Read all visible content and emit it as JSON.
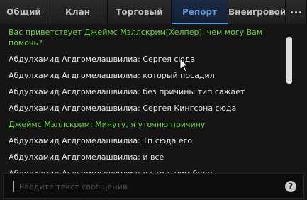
{
  "tabs": [
    {
      "label": "Общий",
      "active": false
    },
    {
      "label": "Клан",
      "active": false
    },
    {
      "label": "Торговый",
      "active": false
    },
    {
      "label": "Репорт",
      "active": true
    },
    {
      "label": "Внеигровой",
      "active": false
    }
  ],
  "messages": [
    {
      "text": "Вас приветствует Джеймс Мэллскрим[Хелпер], чем могу Вам помочь?",
      "kind": "helper"
    },
    {
      "text": "Абдулхамид Агдгомелашвилиа: Сергея сюда",
      "kind": "player"
    },
    {
      "text": "Абдулхамид Агдгомелашвилиа: который посадил",
      "kind": "player"
    },
    {
      "text": "Абдулхамид Агдгомелашвилиа: без причины тип сажает",
      "kind": "player"
    },
    {
      "text": "Абдулхамид Агдгомелашвилиа: Сергея Кингсона сюда",
      "kind": "player"
    },
    {
      "text": "Джеймс Мэллскрим: Минуту, я уточню причину",
      "kind": "helper"
    },
    {
      "text": "Абдулхамид Агдгомелашвилиа: Тп сюда его",
      "kind": "player"
    },
    {
      "text": "Абдулхамид Агдгомелашвилиа: и все",
      "kind": "player"
    },
    {
      "text": "Абдулхамид Агдгомелашвилиа: я сам с ним буду",
      "kind": "player"
    }
  ],
  "input": {
    "placeholder": "Введите текст сообщения",
    "value": ""
  },
  "help_icon": "?",
  "colors": {
    "helper": "#6fd24a",
    "player": "#e6e6e6",
    "active_tab": "#5e95d6"
  },
  "icons": {
    "more": "more-dots-icon",
    "help": "help-icon",
    "cursor": "mouse-cursor-icon"
  }
}
